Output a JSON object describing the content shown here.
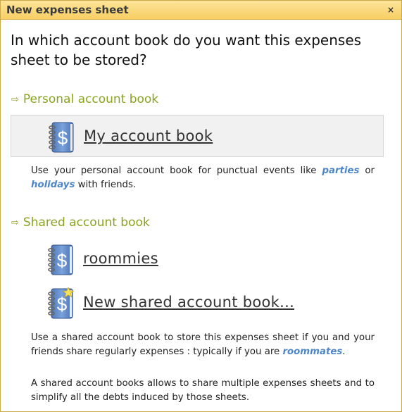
{
  "dialog": {
    "title": "New expenses sheet",
    "close_label": "×"
  },
  "question": "In which account book do you want this expenses sheet to be stored?",
  "personal": {
    "header": "Personal account book",
    "book_label": "My account book",
    "desc_pre": "Use your personal account book for punctual events like ",
    "desc_hl1": "parties",
    "desc_mid": " or ",
    "desc_hl2": "holidays",
    "desc_post": " with friends."
  },
  "shared": {
    "header": "Shared account book",
    "books": [
      {
        "label": "roommies",
        "icon": "account-book-icon"
      },
      {
        "label": "New shared account book...",
        "icon": "new-account-book-icon"
      }
    ],
    "desc1_pre": "Use a shared account book to store this expenses sheet if you and your friends share regularly expenses : typically if you are ",
    "desc1_hl": "roommates",
    "desc1_post": ".",
    "desc2": "A shared account books allows to share multiple expenses sheets and to simplify all the debts induced by those sheets."
  },
  "colors": {
    "accent_green": "#8aa322",
    "link_blue": "#4f86c5",
    "titlebar": "#f7cf63"
  }
}
